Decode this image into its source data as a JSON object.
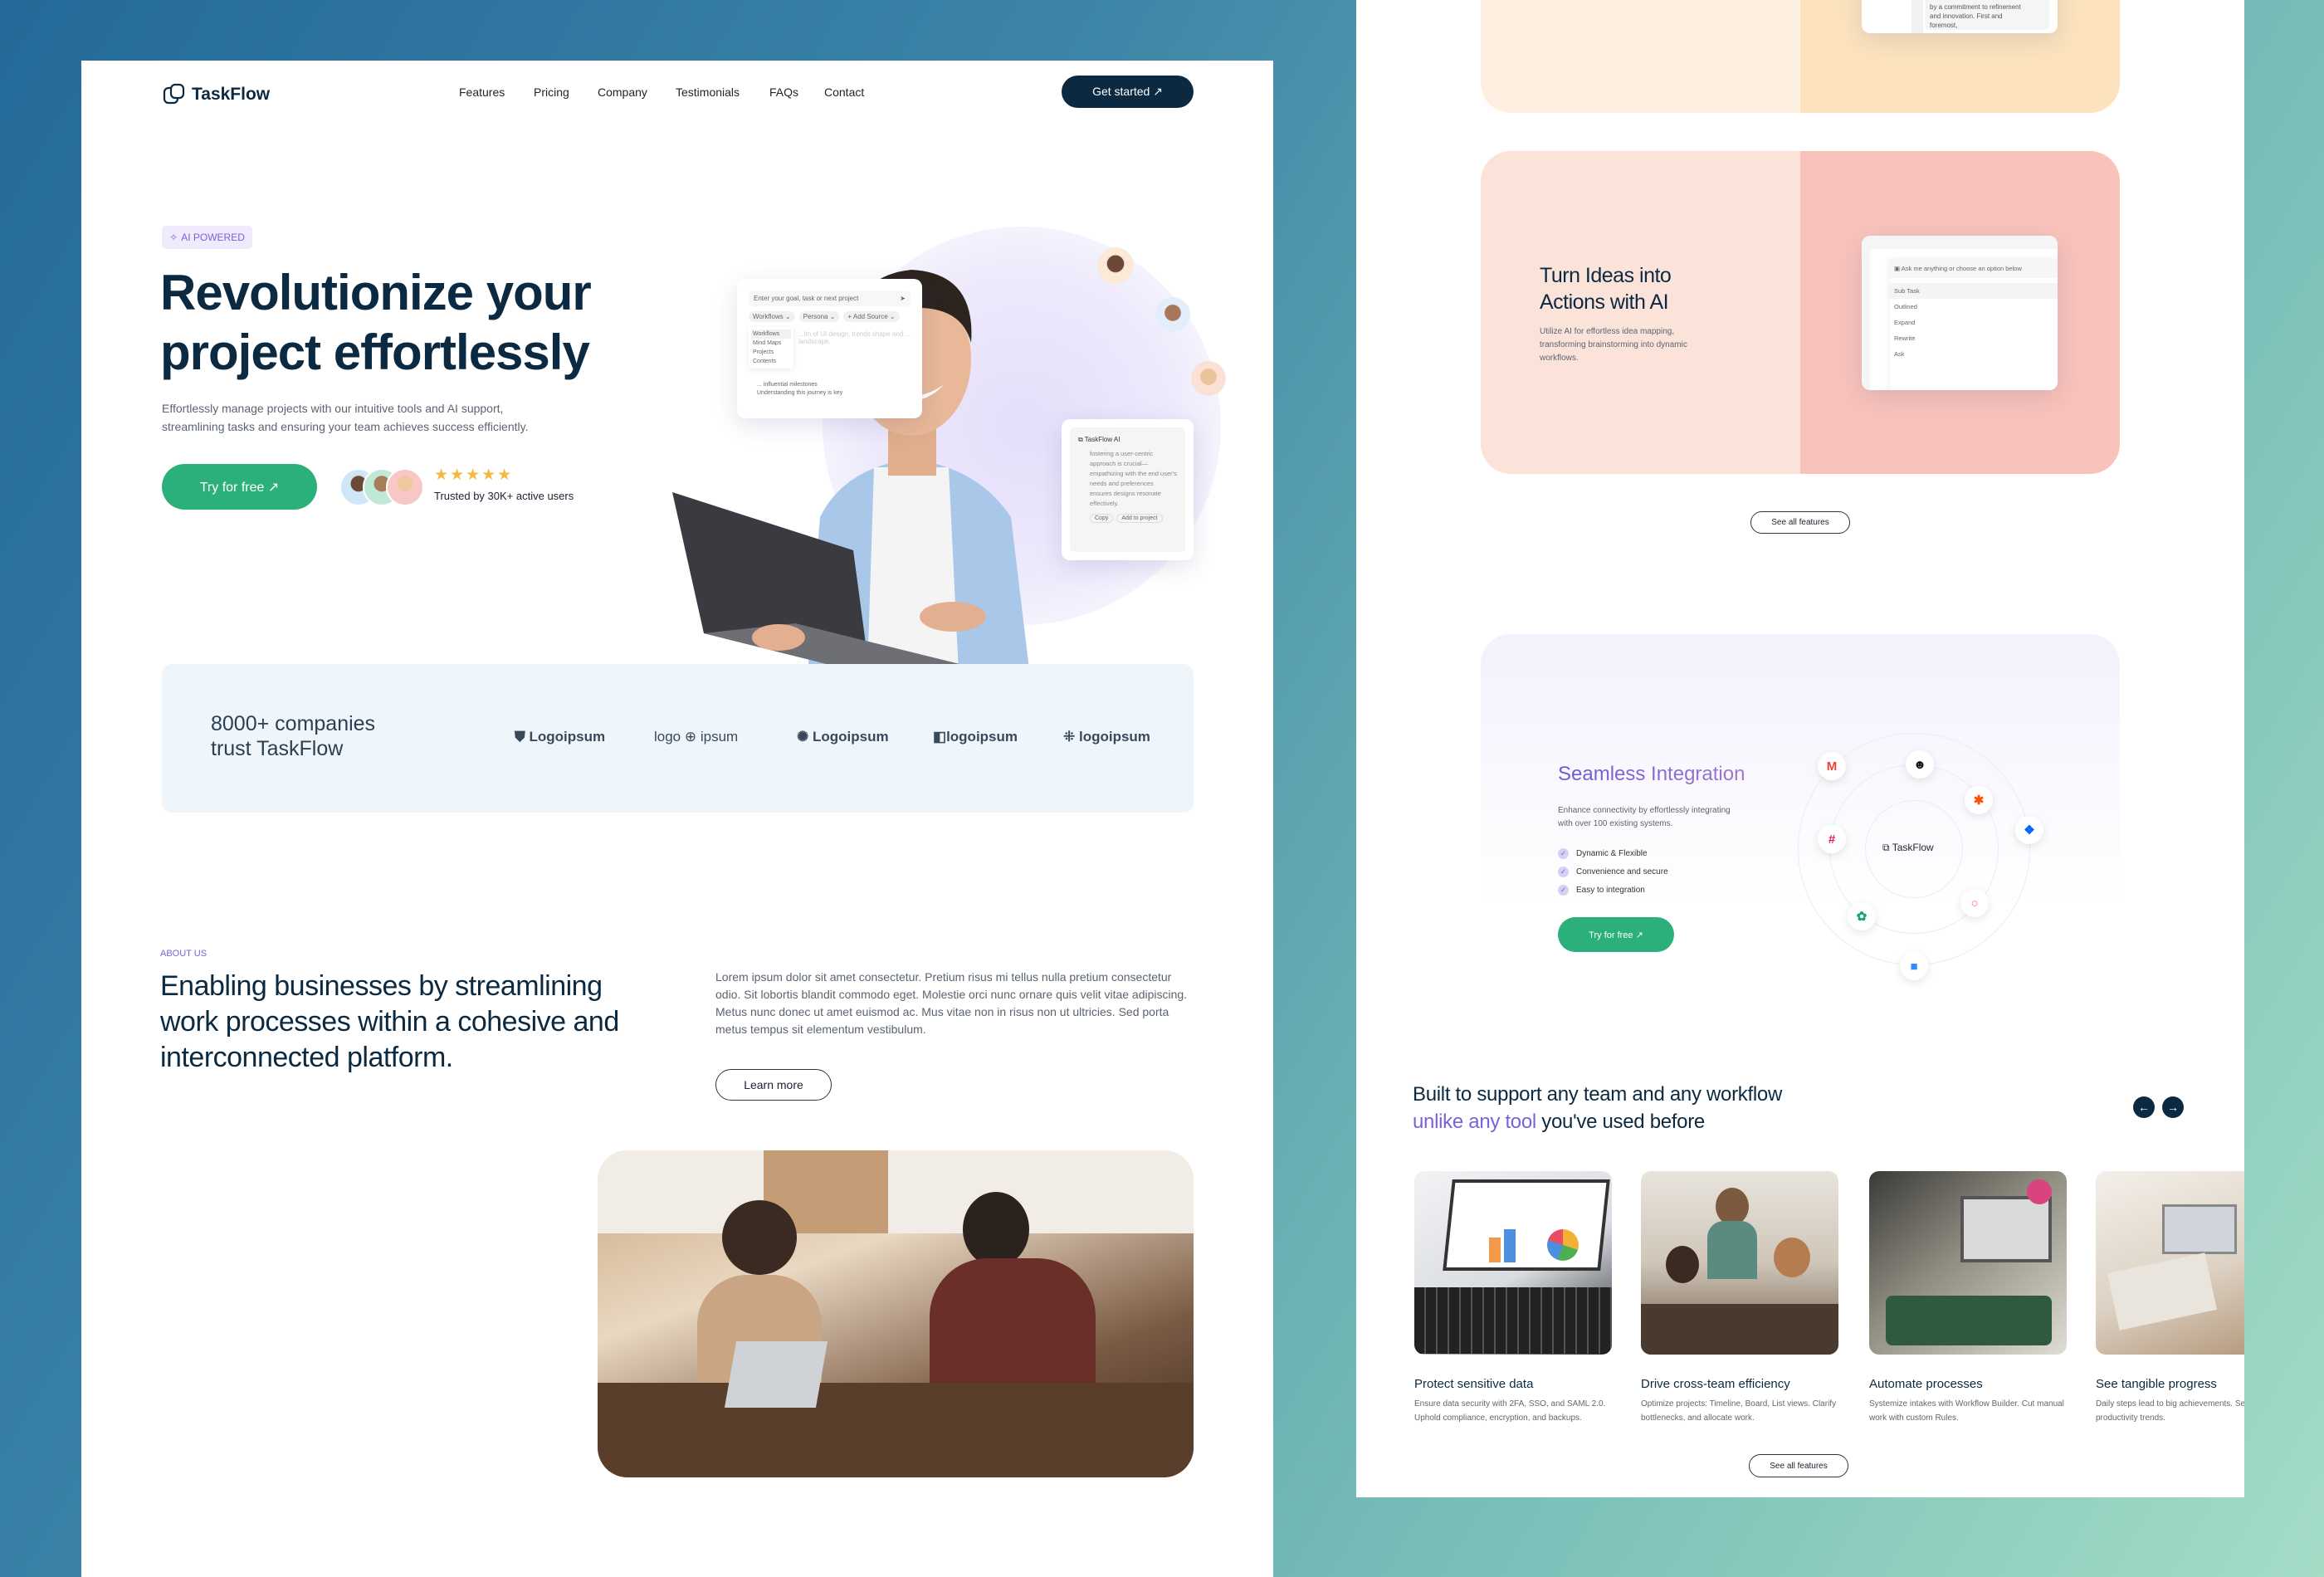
{
  "nav": {
    "brand": "TaskFlow",
    "items": [
      "Features",
      "Pricing",
      "Company",
      "Testimonials",
      "FAQs",
      "Contact"
    ],
    "cta": "Get started ↗"
  },
  "hero": {
    "badge": "AI POWERED",
    "title_line1": "Revolutionize your",
    "title_line2": "project effortlessly",
    "subtitle_line1": "Effortlessly manage projects with our intuitive tools and AI support,",
    "subtitle_line2": "streamlining tasks and ensuring your team achieves success efficiently.",
    "cta": "Try for free ↗",
    "rating_stars": 5,
    "stars": "★★★★★",
    "trusted": "Trusted by 30K+ active users",
    "prompt_card": {
      "placeholder": "Enter your goal, task or next project",
      "chips": [
        "Workflows ⌄",
        "Persona ⌄",
        "+ Add Source ⌄"
      ],
      "menu": [
        "Workflows",
        "Mind Maps",
        "Projects",
        "Contents"
      ],
      "bg_text_1": "...lm of UI design, trends shape and ... landscape.",
      "bullet_1": "... influential milestones",
      "bullet_2": "Understanding this journey is key"
    },
    "ai_card": {
      "title": "TaskFlow AI",
      "body": "fostering a user-centric approach is crucial—empathizing with the end user's needs and preferences ensures designs resonate effectively.",
      "copy": "Copy",
      "add": "Add to project"
    }
  },
  "logos": {
    "headline_line1": "8000+ companies",
    "headline_line2": "trust TaskFlow",
    "items": [
      "Logoipsum",
      "logo ⊕ ipsum",
      "Logoipsum",
      "logoipsum",
      "logoipsum"
    ]
  },
  "about": {
    "eyebrow": "ABOUT US",
    "title_line1": "Enabling businesses by streamlining",
    "title_line2": "work processes within a cohesive and",
    "title_line3": "interconnected platform.",
    "body": "Lorem ipsum dolor sit amet consectetur. Pretium risus mi tellus nulla pretium consectetur odio. Sit lobortis blandit commodo eget. Molestie orci nunc ornare quis velit vitae adipiscing. Metus nunc donec ut amet euismod ac. Mus vitae non in risus non ut ultricies. Sed porta metus tempus sit elementum vestibulum.",
    "cta": "Learn more"
  },
  "feature_top": {
    "mock_text": "by a commitment to refinement and innovation. First and foremost,"
  },
  "feature_ai": {
    "title_line1": "Turn Ideas into",
    "title_line2": "Actions with AI",
    "body": "Utilize AI for effortless idea mapping, transforming brainstorming into dynamic workflows.",
    "mock_prompt": "Ask me anything or choose an option below",
    "mock_options": [
      "Sub Task",
      "Outlined",
      "Expand",
      "Rewrite",
      "Ask"
    ]
  },
  "see_all_1": "See all features",
  "integration": {
    "title": "Seamless Integration",
    "body": "Enhance connectivity by effortlessly integrating with over 100 existing systems.",
    "points": [
      "Dynamic & Flexible",
      "Convenience and secure",
      "Easy to integration"
    ],
    "cta": "Try for free ↗",
    "center": "TaskFlow",
    "apps": [
      {
        "name": "gmail-icon",
        "glyph": "M",
        "color": "#ea4335"
      },
      {
        "name": "mailchimp-icon",
        "glyph": "☻",
        "color": "#111111"
      },
      {
        "name": "zapier-icon",
        "glyph": "✱",
        "color": "#ff4f00"
      },
      {
        "name": "dropbox-icon",
        "glyph": "❖",
        "color": "#0061ff"
      },
      {
        "name": "slack-icon",
        "glyph": "#",
        "color": "#e01e5a"
      },
      {
        "name": "chatgpt-icon",
        "glyph": "✿",
        "color": "#10a37f"
      },
      {
        "name": "convertkit-icon",
        "glyph": "○",
        "color": "#fb6970"
      },
      {
        "name": "zoom-icon",
        "glyph": "■",
        "color": "#2d8cff"
      }
    ]
  },
  "workflow": {
    "title_line1": "Built to support any team and any workflow",
    "title_accent": "unlike any tool",
    "title_rest": " you've used before",
    "cards": [
      {
        "title": "Protect sensitive data",
        "body": "Ensure data security with 2FA, SSO, and SAML 2.0. Uphold compliance, encryption, and backups."
      },
      {
        "title": "Drive cross-team efficiency",
        "body": "Optimize projects: Timeline, Board, List views. Clarify bottlenecks, and allocate work."
      },
      {
        "title": "Automate processes",
        "body": "Systemize intakes with Workflow Builder. Cut manual work with custom Rules."
      },
      {
        "title": "See tangible progress",
        "body": "Daily steps lead to big achievements. Set visualize productivity trends."
      }
    ],
    "cta": "See all features"
  },
  "colors": {
    "navy": "#0b2a42",
    "green": "#2bb07b",
    "purple": "#7b61d9"
  }
}
